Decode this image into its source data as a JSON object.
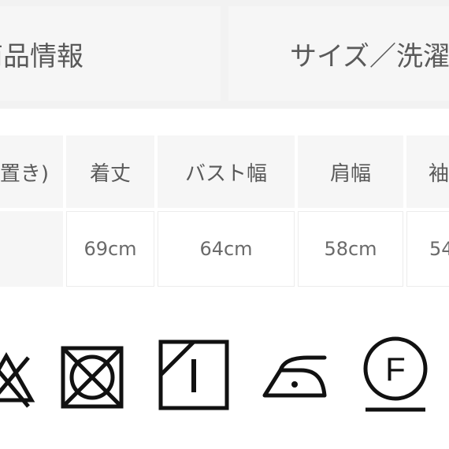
{
  "tabs": [
    {
      "label": "商品情報"
    },
    {
      "label": "サイズ／洗濯"
    }
  ],
  "size_table": {
    "headers": [
      "置き)",
      "着丈",
      "バスト幅",
      "肩幅",
      "袖"
    ],
    "values": [
      "",
      "69cm",
      "64cm",
      "58cm",
      "54"
    ]
  },
  "care_icons": [
    {
      "icon": "no-bleach-icon"
    },
    {
      "icon": "no-tumble-dry-icon"
    },
    {
      "icon": "flat-dry-in-shade-icon"
    },
    {
      "icon": "iron-low-temperature-icon"
    },
    {
      "icon": "dry-clean-f-mild-icon"
    }
  ],
  "care_icon_letters": {
    "dry_clean": "F"
  },
  "colors": {
    "icon_stroke": "#111111",
    "tab_bg": "#f6f6f6",
    "text": "#5a5a5a"
  }
}
